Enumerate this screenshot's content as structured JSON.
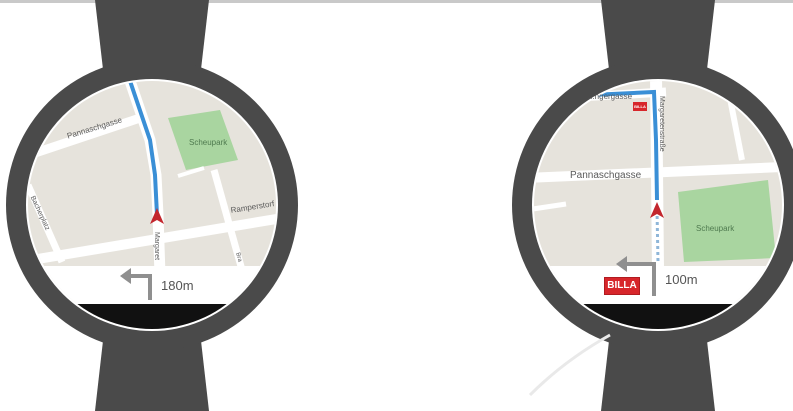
{
  "colors": {
    "band": "#4a4a4a",
    "bezel": "#4a4a4a",
    "map_bg": "#e6e3dc",
    "park": "#a9d5a0",
    "road": "#ffffff",
    "route": "#3a8fd6",
    "nav_bar": "#ffffff",
    "arrow": "#8f8f8f",
    "marker": "#c3262d",
    "billa_red": "#d7262b"
  },
  "watch_left": {
    "streets": {
      "pannaschgasse": "Pannaschgasse",
      "ramperstorffer": "Ramperstorf",
      "margareten": "Margaret",
      "bachplatz": "Bacherplatz",
      "bra": "Bra"
    },
    "park_label": "Scheupark",
    "turn_icon": "turn-left-arrow-icon",
    "distance": "180m"
  },
  "watch_right": {
    "streets": {
      "zeiner": "...ngergasse",
      "pannaschgasse": "Pannaschgasse",
      "margareten": "Margaretenstraße"
    },
    "park_label": "Scheupark",
    "billa_badge": "BILLA",
    "billa_map_badge": "BILLA",
    "turn_icon": "turn-left-arrow-icon",
    "distance": "100m"
  }
}
